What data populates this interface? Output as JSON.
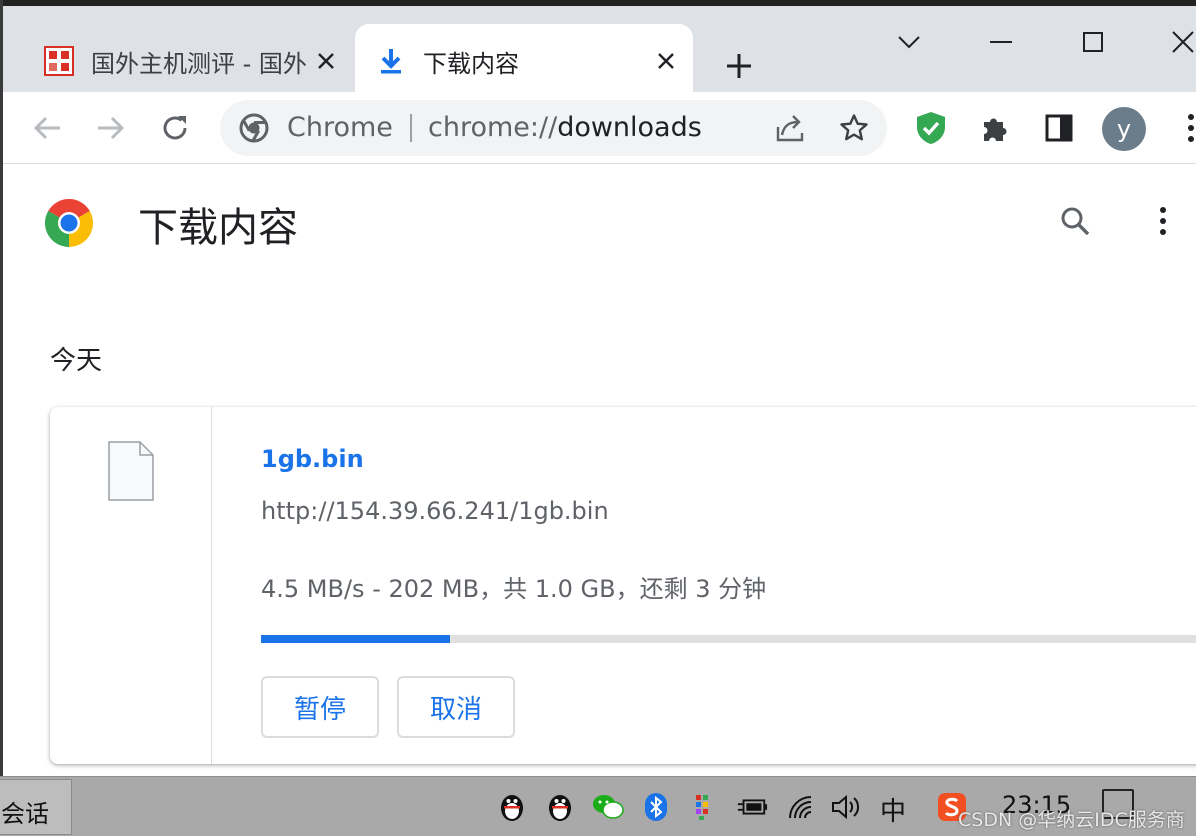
{
  "tabs": [
    {
      "title": "国外主机测评 - 国外",
      "favicon": "site-favicon-red"
    },
    {
      "title": "下载内容",
      "favicon": "download-icon"
    }
  ],
  "omnibox": {
    "chip": "Chrome",
    "url_scheme": "chrome://",
    "url_path": "downloads"
  },
  "profile": {
    "initial": "y"
  },
  "page": {
    "title": "下载内容",
    "section_date": "今天"
  },
  "download": {
    "file_name": "1gb.bin",
    "url": "http://154.39.66.241/1gb.bin",
    "status": "4.5 MB/s - 202 MB，共 1.0 GB，还剩 3 分钟",
    "progress_fraction": 0.197,
    "pause_label": "暂停",
    "cancel_label": "取消"
  },
  "taskbar": {
    "window_label": "会话",
    "ime": "中",
    "clock": "23:15",
    "watermark": "CSDN @华纳云IDC服务商"
  },
  "colors": {
    "accent": "#1a73e8",
    "tab_strip": "#dee1e6",
    "shield_green": "#34a853",
    "taskbar": "#a9a9a9"
  }
}
